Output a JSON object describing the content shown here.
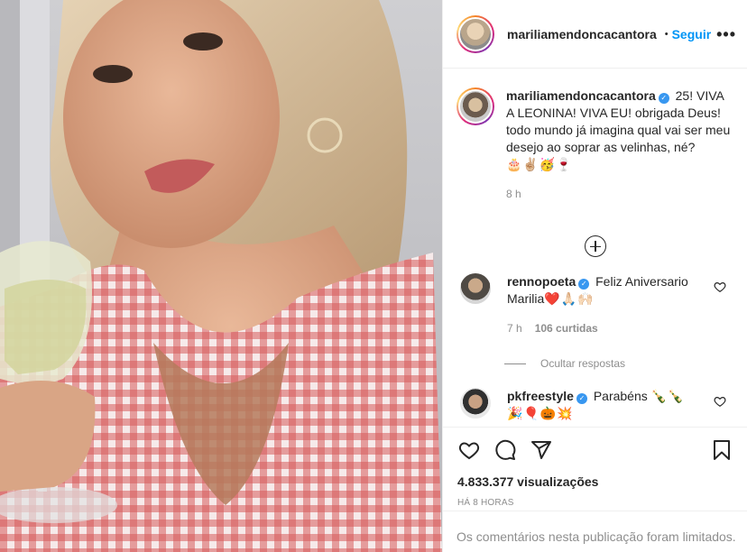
{
  "post": {
    "username": "mariliamendoncacantora",
    "follow_label": "Seguir",
    "separator": "•",
    "more_label": "•••"
  },
  "caption": {
    "username": "mariliamendoncacantora",
    "text": "25! VIVA A LEONINA! VIVA EU! obrigada Deus! todo mundo já imagina qual vai ser meu desejo ao soprar as velinhas, né?",
    "emojis": "🎂✌🏼🥳🍷",
    "time": "8 h"
  },
  "comments": [
    {
      "username": "rennopoeta",
      "text": "Feliz Aniversario Marilia",
      "emojis": "❤️🙏🏻🙌🏻",
      "time": "7 h",
      "likes": "106 curtidas"
    },
    {
      "username": "pkfreestyle",
      "text": "Parabéns",
      "emojis": "🍾🍾🎉🎈🎃💥"
    }
  ],
  "hide_replies_label": "Ocultar respostas",
  "stats": {
    "views": "4.833.377 visualizações",
    "time_ago": "HÁ 8 HORAS"
  },
  "limited_comments": "Os comentários nesta publicação foram limitados.",
  "colors": {
    "accent": "#0095f6",
    "verified": "#3897f0",
    "muted": "#8e8e8e"
  }
}
